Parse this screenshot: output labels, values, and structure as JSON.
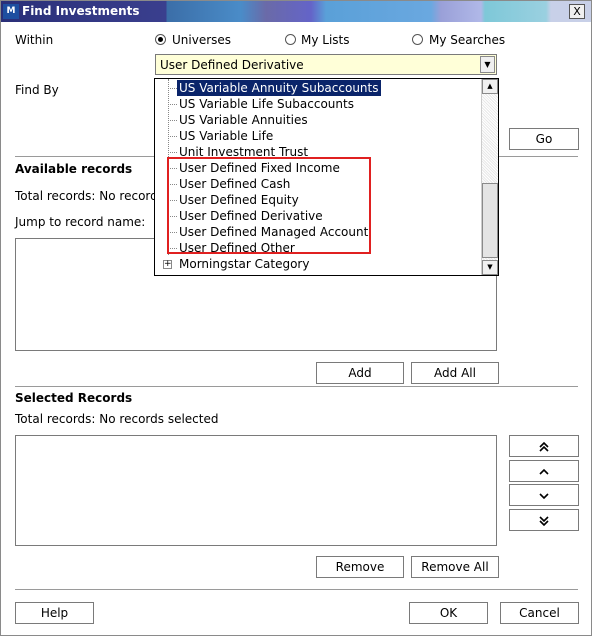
{
  "window": {
    "title": "Find Investments",
    "close_glyph": "X",
    "logo_text": "M"
  },
  "within": {
    "label": "Within",
    "options": [
      "Universes",
      "My Lists",
      "My Searches"
    ],
    "selected": "Universes"
  },
  "universe_combo": {
    "value": "User Defined Derivative"
  },
  "dropdown_items": [
    "US Variable Annuity Subaccounts",
    "US Variable Life Subaccounts",
    "US Variable Annuities",
    "US Variable Life",
    "Unit Investment Trust",
    "User Defined Fixed Income",
    "User Defined Cash",
    "User Defined Equity",
    "User Defined Derivative",
    "User Defined Managed Account",
    "User Defined Other",
    "Morningstar Category"
  ],
  "highlighted_item": "US Variable Annuity Subaccounts",
  "find_by": {
    "label": "Find By"
  },
  "go_button": "Go",
  "available": {
    "heading": "Available records",
    "total_label": "Total records: No record",
    "jump_label": "Jump to record name:"
  },
  "add_button": "Add",
  "add_all_button": "Add All",
  "selected": {
    "heading": "Selected Records",
    "total_label": "Total records: No records selected"
  },
  "remove_button": "Remove",
  "remove_all_button": "Remove All",
  "move_buttons": [
    "move-top-icon",
    "move-up-icon",
    "move-down-icon",
    "move-bottom-icon"
  ],
  "footer": {
    "help": "Help",
    "ok": "OK",
    "cancel": "Cancel"
  },
  "colors": {
    "highlight": "#0a246a",
    "combo_bg": "#ffffd8",
    "annotation_box": "#e02020"
  }
}
